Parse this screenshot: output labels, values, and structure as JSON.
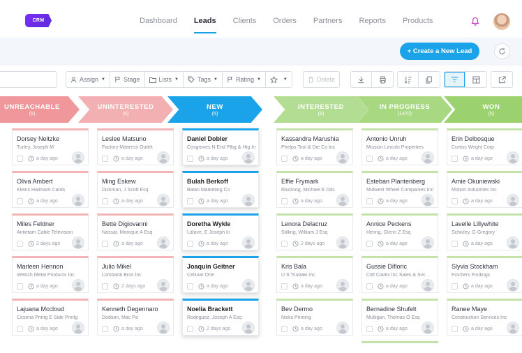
{
  "app": {
    "logo_text": "CRM",
    "nav": [
      {
        "label": "Dashboard",
        "active": false
      },
      {
        "label": "Leads",
        "active": true
      },
      {
        "label": "Clients",
        "active": false
      },
      {
        "label": "Orders",
        "active": false
      },
      {
        "label": "Partners",
        "active": false
      },
      {
        "label": "Reports",
        "active": false
      },
      {
        "label": "Products",
        "active": false
      }
    ],
    "bell_icon": "bell-icon",
    "accent_color": "#1aa3e8"
  },
  "actions": {
    "create_label": "+ Create a New Lead",
    "refresh_icon": "refresh-icon"
  },
  "toolbar": {
    "assign_label": "Assign",
    "stage_label": "Stage",
    "lists_label": "Lists",
    "tags_label": "Tags",
    "rating_label": "Rating",
    "delete_label": "Delete"
  },
  "stages": [
    {
      "name": "UNREACHABLE",
      "count": "(5)",
      "color": "#f0979b"
    },
    {
      "name": "UNINTERESTED",
      "count": "(5)",
      "color": "#f2b0b3"
    },
    {
      "name": "NEW",
      "count": "(5)",
      "color": "#1aa3e8"
    },
    {
      "name": "INTERESTED",
      "count": "(5)",
      "color": "#b4dd94"
    },
    {
      "name": "IN PROGRESS",
      "count": "(1470)",
      "color": "#a8d882"
    },
    {
      "name": "WON",
      "count": "(5)",
      "color": "#9bd26f"
    }
  ],
  "columns": [
    {
      "stage": "UNREACHABLE",
      "color": "#f3b4b6",
      "cards": [
        {
          "name": "Dorsey Neitzke",
          "company": "Turley, Joseph M",
          "ago": "a day ago"
        },
        {
          "name": "Oliva Ambert",
          "company": "Kleins Hallmark Cards",
          "ago": "a day ago"
        },
        {
          "name": "Miles Feldner",
          "company": "Antietam Cable Television",
          "ago": "2 days ago"
        },
        {
          "name": "Marleen Hennon",
          "company": "Welsch Metal Products Inc",
          "ago": "a day ago"
        },
        {
          "name": "Lajuana Mccloud",
          "company": "Cesena Printg E Side Printg",
          "ago": "a day ago"
        }
      ]
    },
    {
      "stage": "UNINTERESTED",
      "color": "#f3b4b6",
      "cards": [
        {
          "name": "Leslee Matsuno",
          "company": "Factory Mattress Outlet",
          "ago": "a day ago"
        },
        {
          "name": "Ming Eskew",
          "company": "Dickman, J Scott Esq",
          "ago": "a day ago"
        },
        {
          "name": "Bette Digiovanni",
          "company": "Nassar, Monique A Esq",
          "ago": "a day ago"
        },
        {
          "name": "Julio Mikel",
          "company": "Lombardi Bros Inc",
          "ago": "2 days ago"
        },
        {
          "name": "Kenneth Degennaro",
          "company": "Dodson, Mac Pa",
          "ago": "a day ago"
        }
      ]
    },
    {
      "stage": "NEW",
      "color": "#1aa3e8",
      "cards": [
        {
          "name": "Daniel Dobler",
          "company": "Cosgroves N End Plbg & Htg Inc",
          "ago": "a day ago"
        },
        {
          "name": "Bulah Berkoff",
          "company": "Balan Marketing Co",
          "ago": "a day ago"
        },
        {
          "name": "Doretha Wykle",
          "company": "Lafave, E Joseph Iii",
          "ago": "a day ago"
        },
        {
          "name": "Joaquin Geitner",
          "company": "Cellular One",
          "ago": "a day ago"
        },
        {
          "name": "Noelia Brackett",
          "company": "Rodriguez, Joseph A Esq",
          "ago": "2 days ago"
        }
      ]
    },
    {
      "stage": "INTERESTED",
      "color": "#c3e3a8",
      "cards": [
        {
          "name": "Kassandra Marushia",
          "company": "Phelps Tool & Die Co Inc",
          "ago": "a day ago"
        },
        {
          "name": "Effie Frymark",
          "company": "Razzoog, Michael E Dds",
          "ago": "a day ago"
        },
        {
          "name": "Lenora Delacruz",
          "company": "Stilling, William J Esq",
          "ago": "2 days ago"
        },
        {
          "name": "Kris Bala",
          "company": "U S Tsubaki Inc",
          "ago": "a day ago"
        },
        {
          "name": "Bev Dermo",
          "company": "Nicks Printing",
          "ago": "a day ago"
        }
      ]
    },
    {
      "stage": "IN PROGRESS",
      "color": "#c3e3a8",
      "cards": [
        {
          "name": "Antonio Unruh",
          "company": "Mission Lincoln Properties",
          "ago": "a day ago"
        },
        {
          "name": "Esteban Plantenberg",
          "company": "Midwest Wheel Companies Inc",
          "ago": "a day ago"
        },
        {
          "name": "Annice Peckens",
          "company": "Hering, Glenn Z Esq",
          "ago": "a day ago"
        },
        {
          "name": "Gussie Difloric",
          "company": "Cliff Clarks Inc Sales & Svc",
          "ago": "a day ago"
        },
        {
          "name": "Bernadine Shufelt",
          "company": "Mulligan, Thomas O Esq",
          "ago": "a day ago"
        }
      ]
    },
    {
      "stage": "WON",
      "color": "#c3e3a8",
      "cards": [
        {
          "name": "Erin Delbosque",
          "company": "Curtiss Wright Corp",
          "ago": "a day ago"
        },
        {
          "name": "Amie Okuniewski",
          "company": "Motion Industries Inc",
          "ago": "a day ago"
        },
        {
          "name": "Lavelle Lillywhite",
          "company": "Schivley, G Gregory",
          "ago": "a day ago"
        },
        {
          "name": "Slyvia Stockham",
          "company": "Finchers Findings",
          "ago": "a day ago"
        },
        {
          "name": "Ranee Maye",
          "company": "Construction Services Inc",
          "ago": "a day ago"
        }
      ]
    }
  ]
}
